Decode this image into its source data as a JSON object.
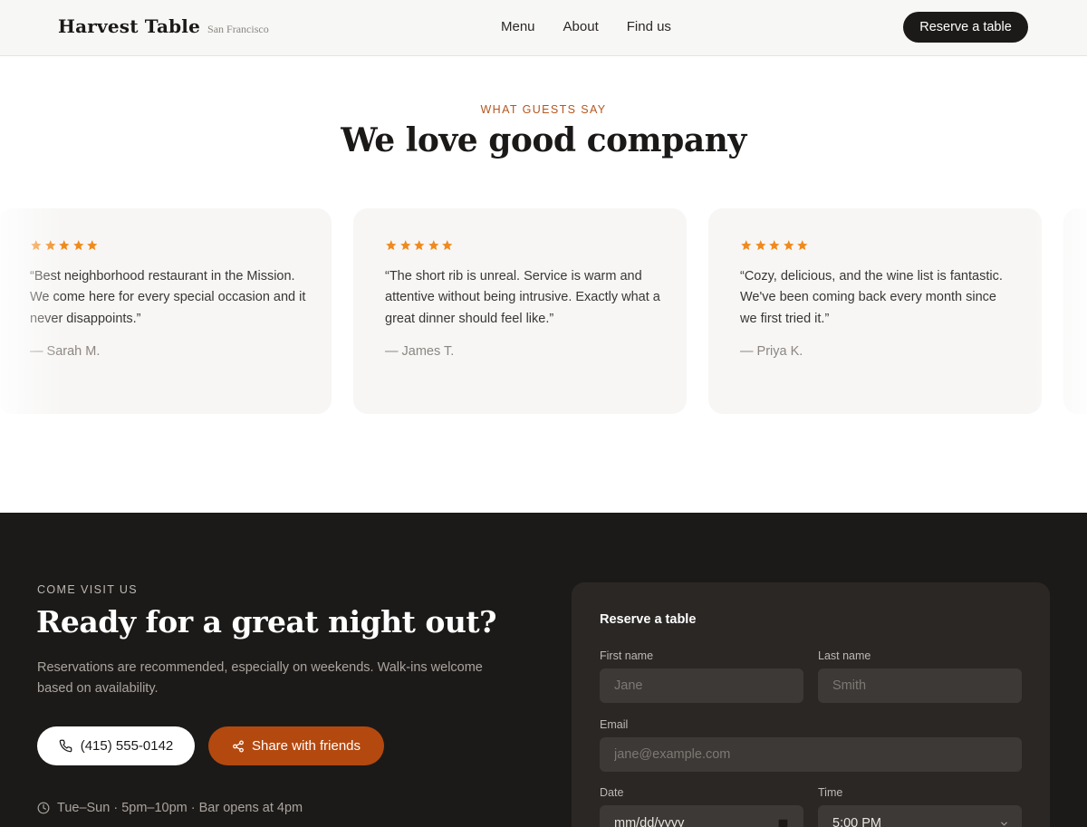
{
  "header": {
    "brand_name": "Harvest Table",
    "brand_city": "San Francisco",
    "nav": [
      "Menu",
      "About",
      "Find us"
    ],
    "cta_label": "Reserve a table"
  },
  "testimonials": {
    "eyebrow": "WHAT GUESTS SAY",
    "title": "We love good company",
    "star_color": "#f08a1c",
    "cards": [
      {
        "rating": 5,
        "quote": "“Best neighborhood restaurant in the Mission. We come here for every special occasion and it never disappoints.”",
        "author": "— Sarah M."
      },
      {
        "rating": 5,
        "quote": "“The short rib is unreal. Service is warm and attentive without being intrusive. Exactly what a great dinner should feel like.”",
        "author": "— James T."
      },
      {
        "rating": 5,
        "quote": "“Cozy, delicious, and the wine list is fantastic. We've been coming back every month since we first tried it.”",
        "author": "— Priya K."
      }
    ]
  },
  "visit": {
    "eyebrow": "COME VISIT US",
    "title": "Ready for a great night out?",
    "description": "Reservations are recommended, especially on weekends. Walk-ins welcome based on availability.",
    "phone_label": "(415) 555-0142",
    "share_label": "Share with friends",
    "hours": "Tue–Sun · 5pm–10pm · Bar opens at 4pm",
    "accent_color": "#b4490f"
  },
  "reservation_form": {
    "title": "Reserve a table",
    "first_name_label": "First name",
    "first_name_placeholder": "Jane",
    "last_name_label": "Last name",
    "last_name_placeholder": "Smith",
    "email_label": "Email",
    "email_placeholder": "jane@example.com",
    "date_label": "Date",
    "date_value": "mm/dd/yyyy",
    "time_label": "Time",
    "time_value": "5:00 PM"
  }
}
